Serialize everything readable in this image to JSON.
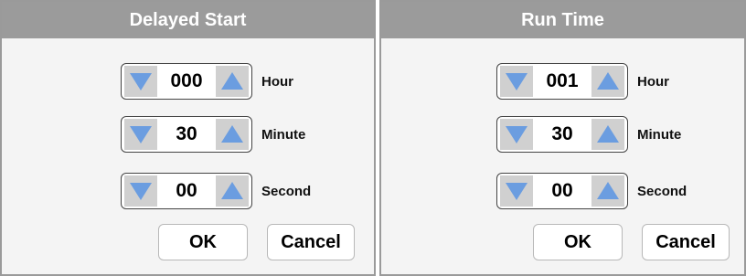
{
  "delayed_start": {
    "title": "Delayed Start",
    "hour": {
      "value": "000",
      "unit": "Hour"
    },
    "minute": {
      "value": "30",
      "unit": "Minute"
    },
    "second": {
      "value": "00",
      "unit": "Second"
    },
    "ok_label": "OK",
    "cancel_label": "Cancel"
  },
  "run_time": {
    "title": "Run Time",
    "hour": {
      "value": "001",
      "unit": "Hour"
    },
    "minute": {
      "value": "30",
      "unit": "Minute"
    },
    "second": {
      "value": "00",
      "unit": "Second"
    },
    "ok_label": "OK",
    "cancel_label": "Cancel"
  },
  "icons": {
    "decrement": "triangle-down-icon",
    "increment": "triangle-up-icon"
  },
  "colors": {
    "header": "#9b9b9b",
    "arrow": "#6b9de0",
    "arrow_button_bg": "#d0d0d0",
    "panel_bg": "#f4f4f4"
  }
}
